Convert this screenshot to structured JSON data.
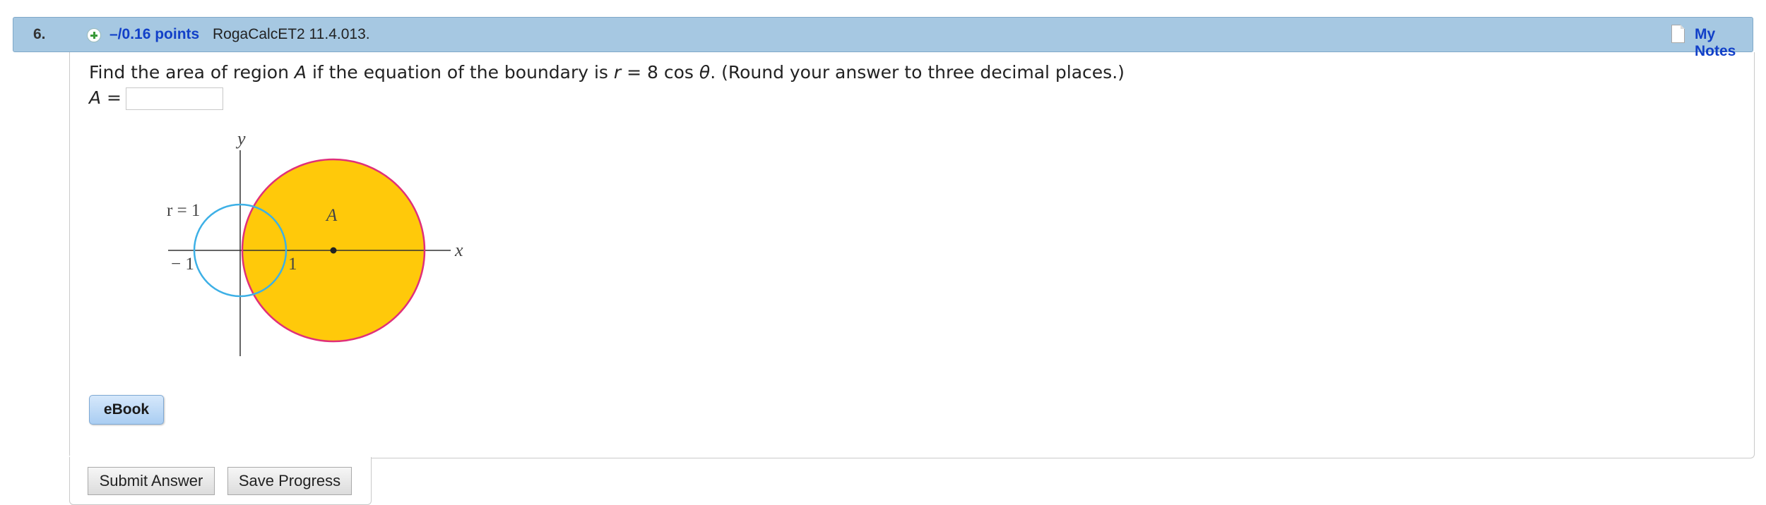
{
  "header": {
    "number": "6.",
    "points": "–/0.16 points",
    "reference": "RogaCalcET2 11.4.013.",
    "my_notes": "My Notes"
  },
  "question": {
    "prompt_start": "Find the area of region ",
    "region_var": "A",
    "prompt_mid": " if the equation of the boundary is  ",
    "equation_r": "r",
    "equation_rest": " = 8 cos ",
    "equation_theta": "θ",
    "prompt_end": ".  (Round your answer to three decimal places.)",
    "answer_var": "A",
    "answer_equals": " =",
    "answer_value": ""
  },
  "figure": {
    "label_y": "y",
    "label_x": "x",
    "label_r1": "r = 1",
    "label_A": "A",
    "label_neg1": "− 1",
    "label_1": "1",
    "colors": {
      "region": "#ffc90a",
      "outer_circle": "#e0307a",
      "unit_circle": "#3db0e6",
      "axis": "#333333"
    }
  },
  "buttons": {
    "ebook": "eBook",
    "submit": "Submit Answer",
    "save": "Save Progress"
  }
}
